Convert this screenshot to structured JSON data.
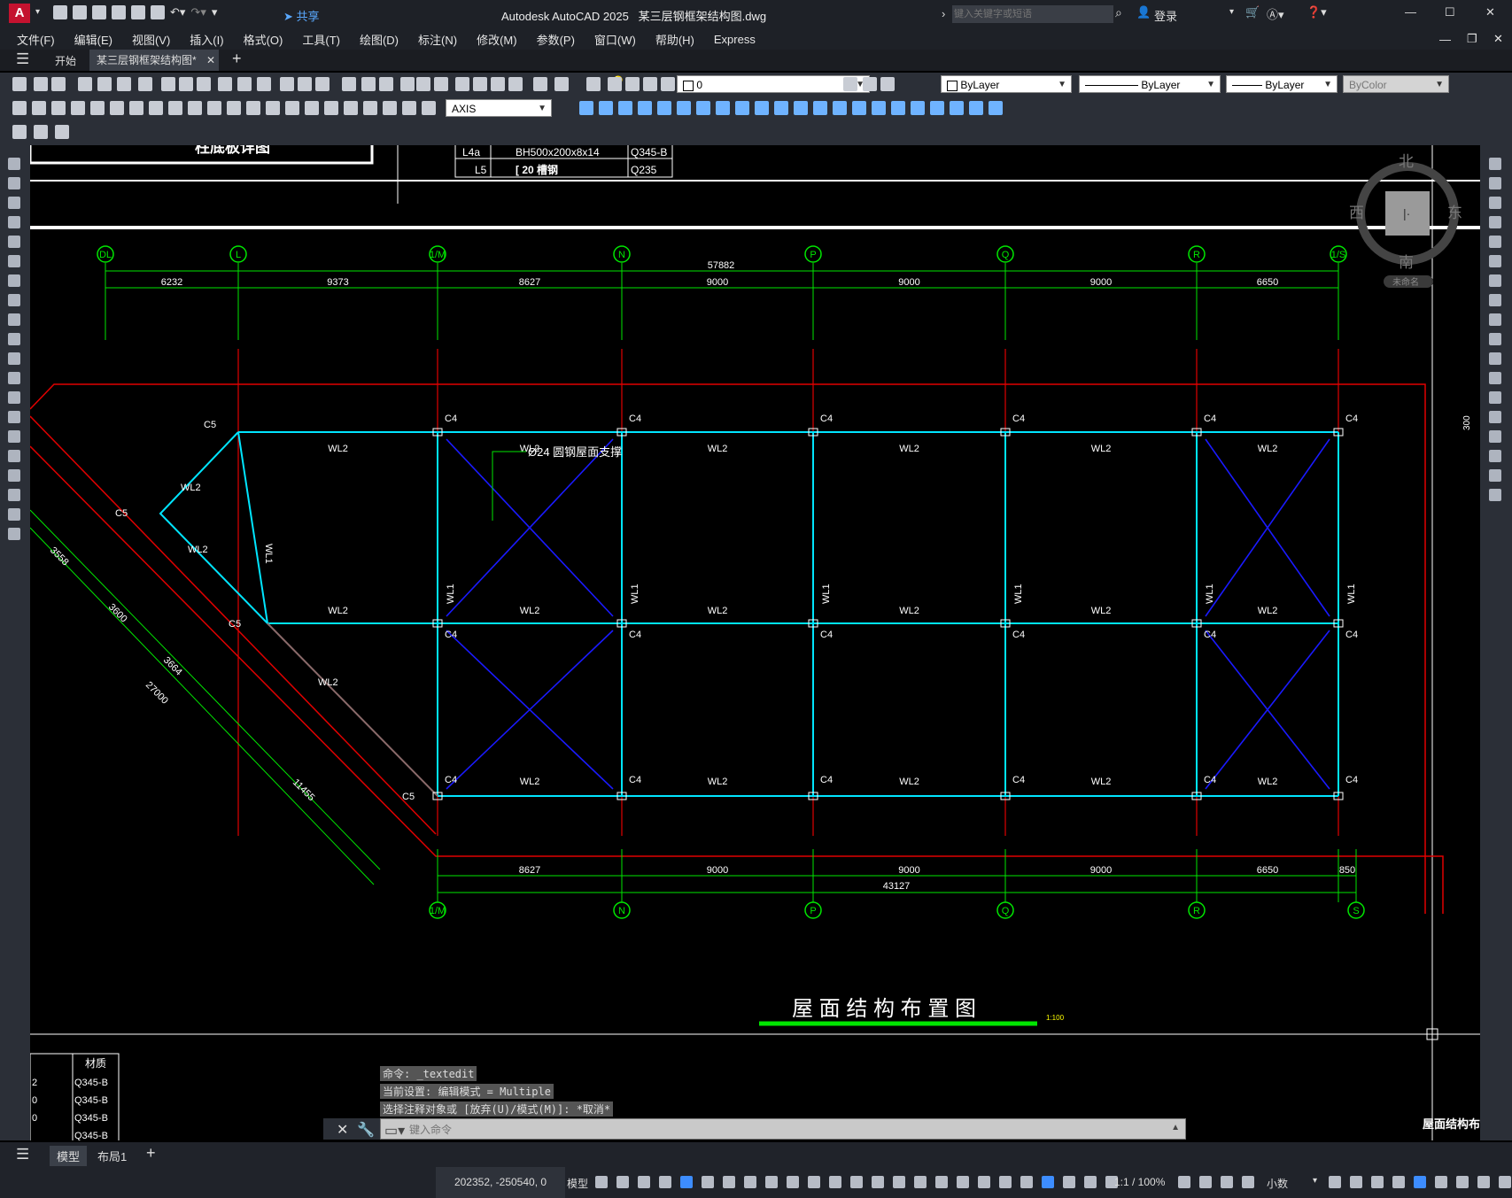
{
  "app": {
    "title": "Autodesk AutoCAD 2025",
    "filename": "某三层钢框架结构图.dwg",
    "search_placeholder": "键入关键字或短语",
    "login": "登录",
    "share": "共享"
  },
  "menu": [
    "文件(F)",
    "编辑(E)",
    "视图(V)",
    "插入(I)",
    "格式(O)",
    "工具(T)",
    "绘图(D)",
    "标注(N)",
    "修改(M)",
    "参数(P)",
    "窗口(W)",
    "帮助(H)",
    "Express"
  ],
  "tabs": {
    "start": "开始",
    "active": "某三层钢框架结构图*"
  },
  "toolbar": {
    "layer": "0",
    "color": "ByLayer",
    "linetype": "ByLayer",
    "lineweight": "ByLayer",
    "plotstyle": "ByColor",
    "dimstyle": "AXIS"
  },
  "compass": {
    "north": "北",
    "south": "南",
    "east": "东",
    "west": "西",
    "ucs": "未命名"
  },
  "drawing": {
    "detail_title": "柱底板详图",
    "table_rows": [
      {
        "id": "L4a",
        "section": "BH500x200x8x14",
        "material": "Q345-B"
      },
      {
        "id": "L5",
        "section": "[ 20 槽钢",
        "material": "Q235"
      }
    ],
    "axes_top": [
      "DL",
      "L",
      "1/M",
      "N",
      "P",
      "Q",
      "R",
      "1/S"
    ],
    "axes_bottom": [
      "1/M",
      "N",
      "P",
      "Q",
      "R",
      "S"
    ],
    "dims_top": [
      "6232",
      "9373",
      "8627",
      "9000",
      "9000",
      "9000",
      "6650"
    ],
    "dim_top_total": "57882",
    "dims_bottom": [
      "8627",
      "9000",
      "9000",
      "9000",
      "6650",
      "850"
    ],
    "dim_bottom_total": "43127",
    "diag_dims": [
      "3558",
      "3600",
      "3664",
      "27000",
      "11455"
    ],
    "brace_note": "Ø24 圆钢屋面支撑",
    "beam_wl2": "WL2",
    "beam_wl1": "WL1",
    "col_c4": "C4",
    "col_c5": "C5",
    "side_dim": "300",
    "plan_title": "屋 面 结 构 布 置 图",
    "plan_scale": "1:100",
    "bottom_table_head": "材质",
    "bottom_table_vals": [
      "Q345-B",
      "Q345-B",
      "Q345-B",
      "Q345-B"
    ],
    "bottom_table_ids": [
      "2",
      "0",
      "0"
    ],
    "right_label": "屋面结构布置"
  },
  "command": {
    "history": [
      "命令: _textedit",
      "当前设置: 编辑模式 = Multiple",
      "选择注释对象或 [放弃(U)/模式(M)]: *取消*"
    ],
    "placeholder": "键入命令"
  },
  "layouts": {
    "model": "模型",
    "layout1": "布局1"
  },
  "status": {
    "coords": "202352, -250540, 0",
    "mode": "模型",
    "scale": "1:1 / 100%",
    "units": "小数"
  },
  "colors": {
    "cyan_beam": "#00e5ff",
    "blue_brace": "#1a1aff",
    "green_dim": "#00e600",
    "red_axis": "#e00000",
    "bg": "#000000"
  }
}
